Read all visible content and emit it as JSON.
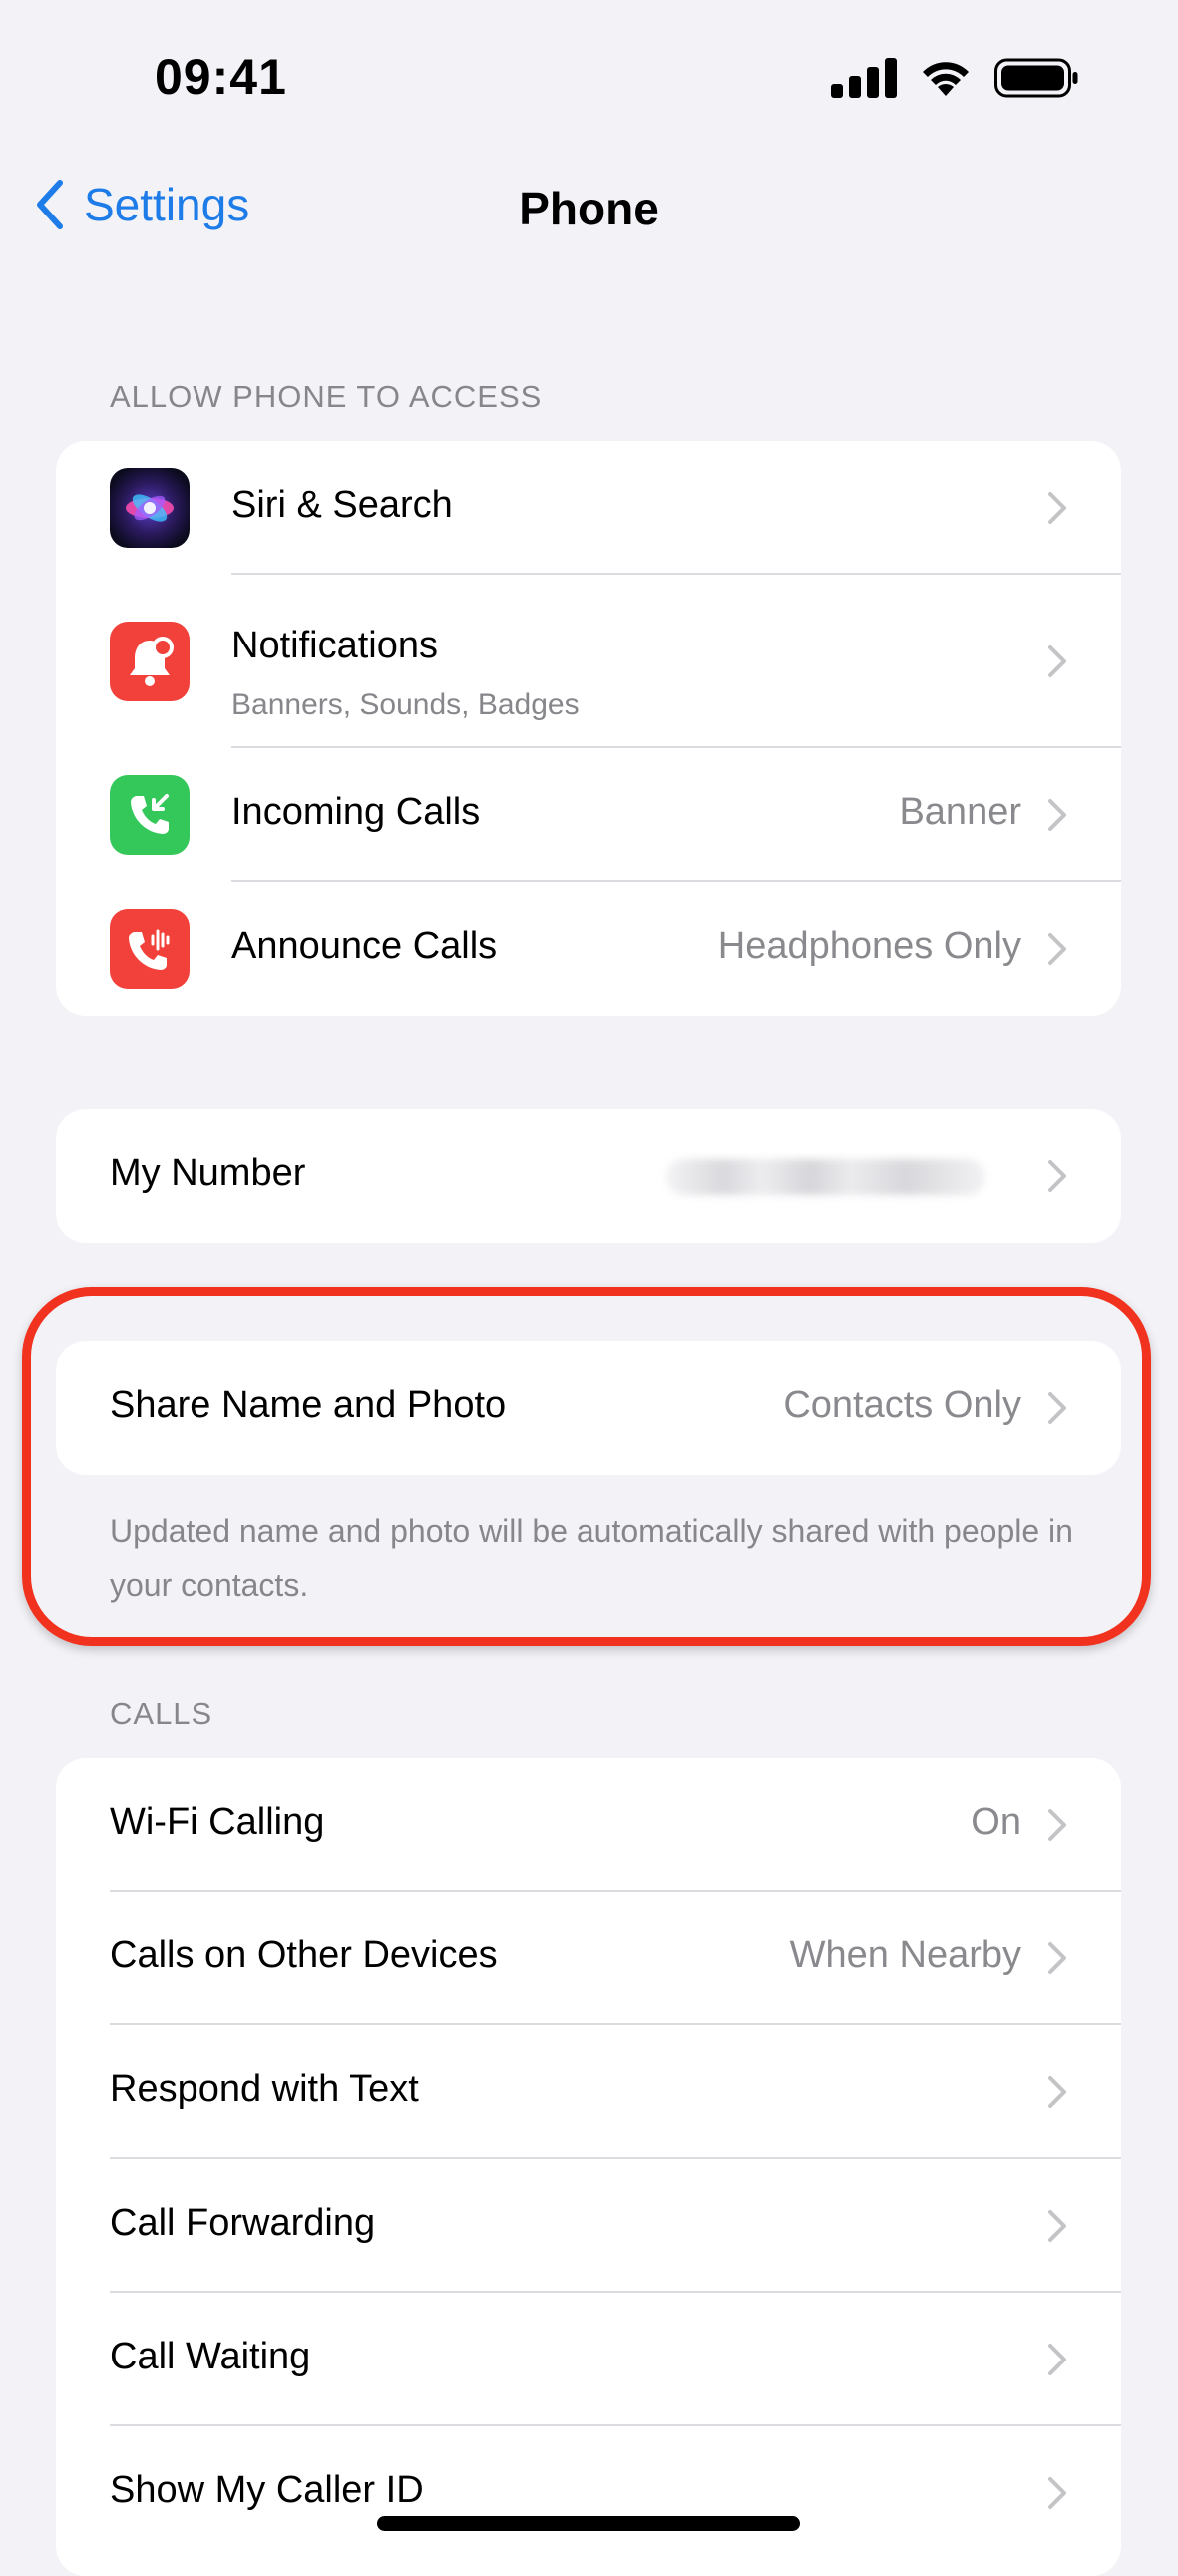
{
  "status_bar": {
    "time": "09:41"
  },
  "nav": {
    "back_label": "Settings",
    "title": "Phone"
  },
  "sections": {
    "access_header": "ALLOW PHONE TO ACCESS",
    "calls_header": "CALLS"
  },
  "access_group": {
    "siri": {
      "label": "Siri & Search",
      "icon": "siri-icon"
    },
    "notifications": {
      "label": "Notifications",
      "subtitle": "Banners, Sounds, Badges",
      "icon": "bell-icon"
    },
    "incoming_calls": {
      "label": "Incoming Calls",
      "value": "Banner",
      "icon": "incoming-call-icon"
    },
    "announce_calls": {
      "label": "Announce Calls",
      "value": "Headphones Only",
      "icon": "announce-call-icon"
    }
  },
  "my_number": {
    "label": "My Number"
  },
  "share_name": {
    "label": "Share Name and Photo",
    "value": "Contacts Only",
    "footnote": "Updated name and photo will be automatically shared with people in your contacts."
  },
  "calls_group": [
    {
      "label": "Wi-Fi Calling",
      "value": "On"
    },
    {
      "label": "Calls on Other Devices",
      "value": "When Nearby"
    },
    {
      "label": "Respond with Text",
      "value": ""
    },
    {
      "label": "Call Forwarding",
      "value": ""
    },
    {
      "label": "Call Waiting",
      "value": ""
    },
    {
      "label": "Show My Caller ID",
      "value": ""
    }
  ],
  "colors": {
    "accent": "#1E7CE8",
    "background": "#F2F2F7",
    "highlight": "#F0321E",
    "notification_red": "#F2413A",
    "call_green": "#34C759"
  }
}
